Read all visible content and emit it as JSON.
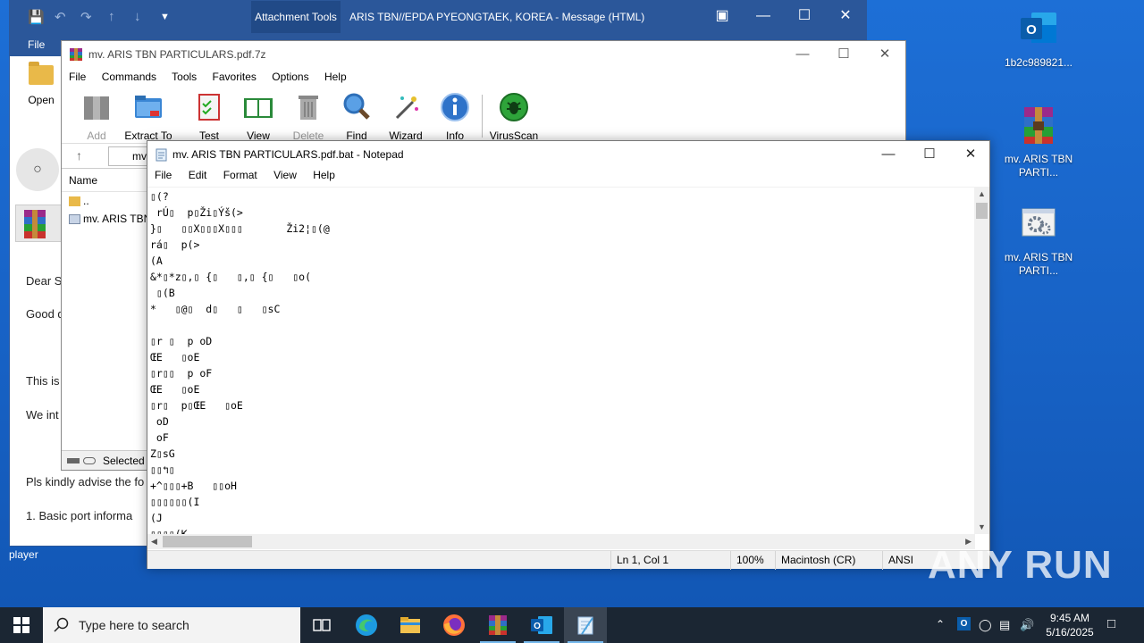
{
  "desktop": {
    "icons": [
      {
        "label": "1b2c989821..."
      },
      {
        "label": "mv. ARIS TBN PARTI..."
      },
      {
        "label": "mv. ARIS TBN PARTI..."
      }
    ]
  },
  "outlook": {
    "attachment_tools": "Attachment Tools",
    "subject": "ARIS TBN//EPDA PYEONGTAEK, KOREA  -  Message (HTML)",
    "file_tab": "File",
    "open_label": "Open",
    "body_lines": [
      "Dear Si",
      "Good d",
      "This is",
      "We int",
      "Pls kindly advise the fo",
      "1.     Basic port informa"
    ],
    "player_label": "player"
  },
  "zip": {
    "title": "mv. ARIS TBN PARTICULARS.pdf.7z",
    "menu": [
      "File",
      "Commands",
      "Tools",
      "Favorites",
      "Options",
      "Help"
    ],
    "toolbar": [
      {
        "label": "Add"
      },
      {
        "label": "Extract To"
      },
      {
        "label": "Test"
      },
      {
        "label": "View"
      },
      {
        "label": "Delete"
      },
      {
        "label": "Find"
      },
      {
        "label": "Wizard"
      },
      {
        "label": "Info"
      },
      {
        "label": "VirusScan"
      }
    ],
    "path_fragment": "mv",
    "list_header": "Name",
    "rows": [
      "..",
      "mv. ARIS TBN"
    ],
    "status": "Selected"
  },
  "notepad": {
    "title": "mv. ARIS TBN PARTICULARS.pdf.bat - Notepad",
    "menu": [
      "File",
      "Edit",
      "Format",
      "View",
      "Help"
    ],
    "text": "▯(?\n rÚ▯  p▯Ži▯Ýš(>\n}▯   ▯▯X▯▯▯X▯▯▯       Ži2¦▯(@\nrá▯  p(>\n(A\n&*▯*z▯,▯ {▯   ▯,▯ {▯   ▯o(\n ▯(B\n*   ▯@▯  d▯   ▯   ▯sC\n\n▯r ▯  p oD\nŒE   ▯oE\n▯r▯▯  p oF\nŒE   ▯oE\n▯r▯  p▯ŒE   ▯oE\n oD\n oF\nZ▯sG\n▯▯↰▯\n+^▯▯▯+B   ▯▯oH\n▯▯▯▯▯▯(I\n(J\n▯▯▯▯(K",
    "status": {
      "position": "Ln 1, Col 1",
      "zoom": "100%",
      "line_ending": "Macintosh (CR)",
      "encoding": "ANSI"
    }
  },
  "taskbar": {
    "search_placeholder": "Type here to search",
    "time": "9:45 AM",
    "date": "5/16/2025"
  },
  "watermark": "ANY RUN"
}
